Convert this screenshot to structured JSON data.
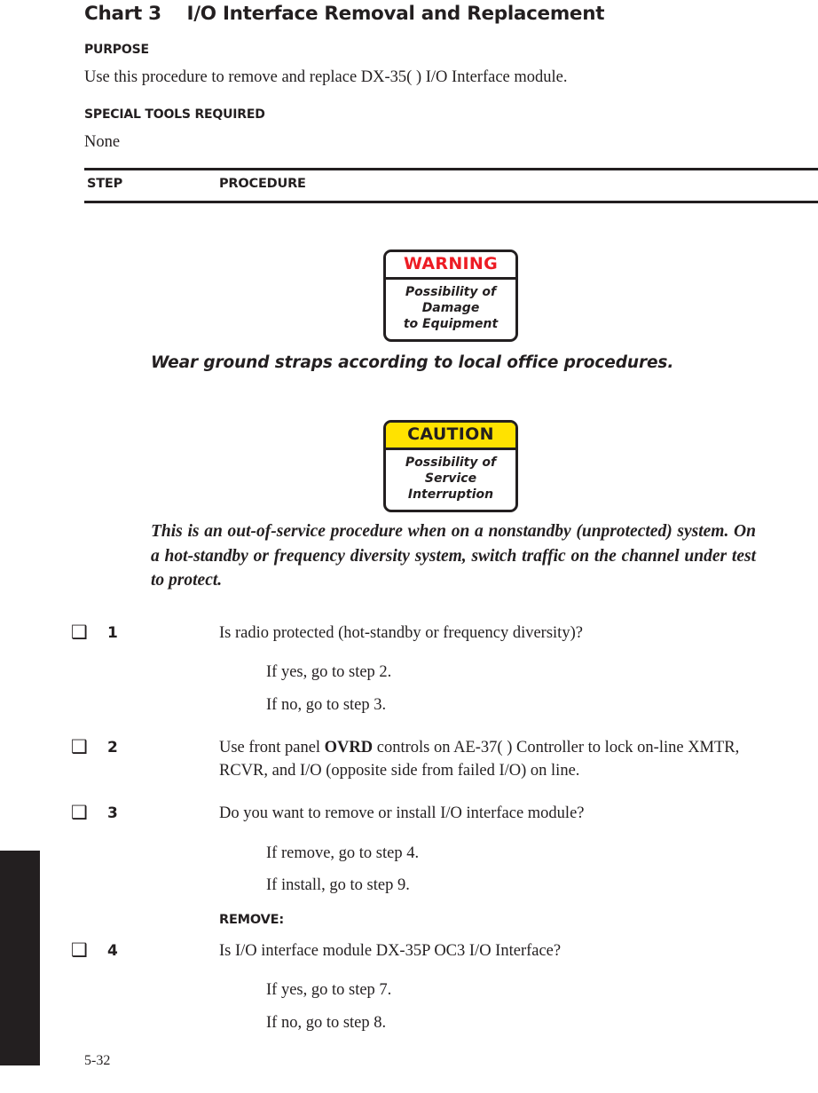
{
  "chart": {
    "number": "Chart 3",
    "title": "I/O Interface Removal and Replacement",
    "heading": "Chart 3    I/O Interface Removal and Replacement"
  },
  "purpose": {
    "heading": "PURPOSE",
    "text": "Use this procedure to remove and replace DX-35( ) I/O Interface module."
  },
  "special_tools": {
    "heading": "SPECIAL TOOLS REQUIRED",
    "text": "None"
  },
  "table_header": {
    "step": "STEP",
    "procedure": "PROCEDURE"
  },
  "warning_box": {
    "header": "WARNING",
    "body": "Possibility of\nDamage\nto Equipment",
    "header_color": "#ed1c24",
    "header_bg": "#ffffff",
    "border_color": "#231f20"
  },
  "warning_statement": "Wear ground straps according to local office procedures.",
  "caution_box": {
    "header": "CAUTION",
    "body": "Possibility of\nService\nInterruption",
    "header_color": "#231f20",
    "header_bg": "#ffe200",
    "border_color": "#231f20"
  },
  "caution_statement": "This is an out-of-service procedure when on a nonstandby (unprotected) system. On a hot-standby or frequency diversity system, switch traffic on the channel under test to protect.",
  "checkbox_glyph": "❑",
  "steps": [
    {
      "number": "1",
      "text": "Is radio protected (hot-standby or frequency diversity)?",
      "sublines": [
        "If yes, go to step 2.",
        "If no, go to step 3."
      ]
    },
    {
      "number": "2",
      "text_before": "Use front panel ",
      "bold": "OVRD",
      "text_after": " controls on AE-37( ) Controller to lock on-line XMTR, RCVR, and I/O (opposite side from failed I/O) on line.",
      "sublines": []
    },
    {
      "number": "3",
      "text": "Do you want to remove or install I/O interface module?",
      "sublines": [
        "If remove, go to step 4.",
        "If install, go to step 9."
      ]
    },
    {
      "number": "4",
      "subhead": "REMOVE:",
      "text": "Is I/O interface module DX-35P OC3 I/O Interface?",
      "sublines": [
        "If yes, go to step 7.",
        "If no, go to step 8."
      ]
    }
  ],
  "footer": {
    "page_number": "5-32"
  }
}
